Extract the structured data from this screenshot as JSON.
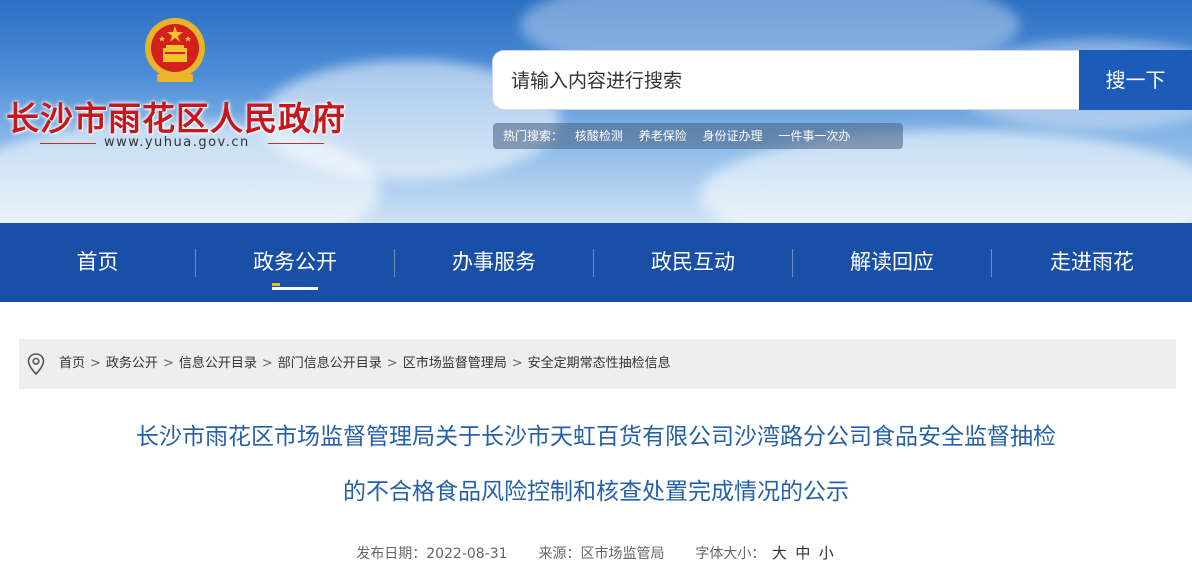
{
  "site": {
    "name": "长沙市雨花区人民政府",
    "url": "www.yuhua.gov.cn"
  },
  "search": {
    "placeholder": "请输入内容进行搜索",
    "button_label": "搜一下",
    "hot_label": "热门搜索：",
    "hot_items": [
      "核酸检测",
      "养老保险",
      "身份证办理",
      "一件事一次办"
    ]
  },
  "nav": {
    "items": [
      "首页",
      "政务公开",
      "办事服务",
      "政民互动",
      "解读回应",
      "走进雨花"
    ],
    "active": "政务公开"
  },
  "breadcrumb": [
    "首页",
    "政务公开",
    "信息公开目录",
    "部门信息公开目录",
    "区市场监督管理局",
    "安全定期常态性抽检信息"
  ],
  "article": {
    "title_line1": "长沙市雨花区市场监督管理局关于长沙市天虹百货有限公司沙湾路分公司食品安全监督抽检",
    "title_line2": "的不合格食品风险控制和核查处置完成情况的公示",
    "publish_label": "发布日期：",
    "publish_date": "2022-08-31",
    "source_label": "来源：",
    "source": "区市场监管局",
    "font_size_label": "字体大小：",
    "font_sizes": [
      "大",
      "中",
      "小"
    ]
  },
  "colors": {
    "nav_bg": "#1a4fa8",
    "search_button": "#1c5bb8",
    "site_name": "#c8161d",
    "title": "#2560a8"
  }
}
